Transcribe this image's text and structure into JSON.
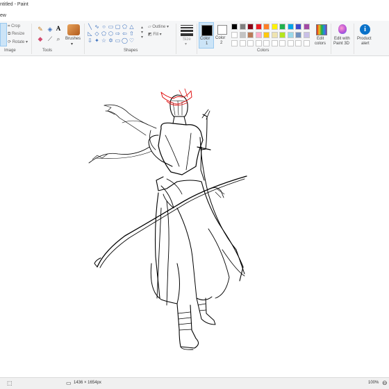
{
  "window": {
    "title": "ntitled - Paint"
  },
  "menu": {
    "view_label": "ew"
  },
  "ribbon": {
    "image": {
      "label": "Image",
      "crop": "Crop",
      "resize": "Resize",
      "rotate": "Rotate"
    },
    "tools": {
      "label": "Tools"
    },
    "brushes": {
      "label": "Brushes"
    },
    "shapes": {
      "label": "Shapes",
      "outline": "Outline",
      "fill": "Fill"
    },
    "size": {
      "label": "Size"
    },
    "color1": {
      "label": "Color",
      "label2": "1"
    },
    "color2": {
      "label": "Color",
      "label2": "2"
    },
    "colors": {
      "label": "Colors"
    },
    "edit_colors": {
      "label": "Edit",
      "label2": "colors"
    },
    "edit_paint3d": {
      "label": "Edit with",
      "label2": "Paint 3D"
    },
    "product_alert": {
      "label": "Product",
      "label2": "alert"
    },
    "palette": [
      "#000000",
      "#7f7f7f",
      "#880015",
      "#ed1c24",
      "#ff7f27",
      "#fff200",
      "#22b14c",
      "#00a2e8",
      "#3f48cc",
      "#a349a4",
      "#ffffff",
      "#c3c3c3",
      "#b97a57",
      "#ffaec9",
      "#ffc90e",
      "#efe4b0",
      "#b5e61d",
      "#99d9ea",
      "#7092be",
      "#c8bfe7"
    ]
  },
  "status": {
    "dimensions": "1436 × 1654px",
    "zoom": "100%"
  }
}
